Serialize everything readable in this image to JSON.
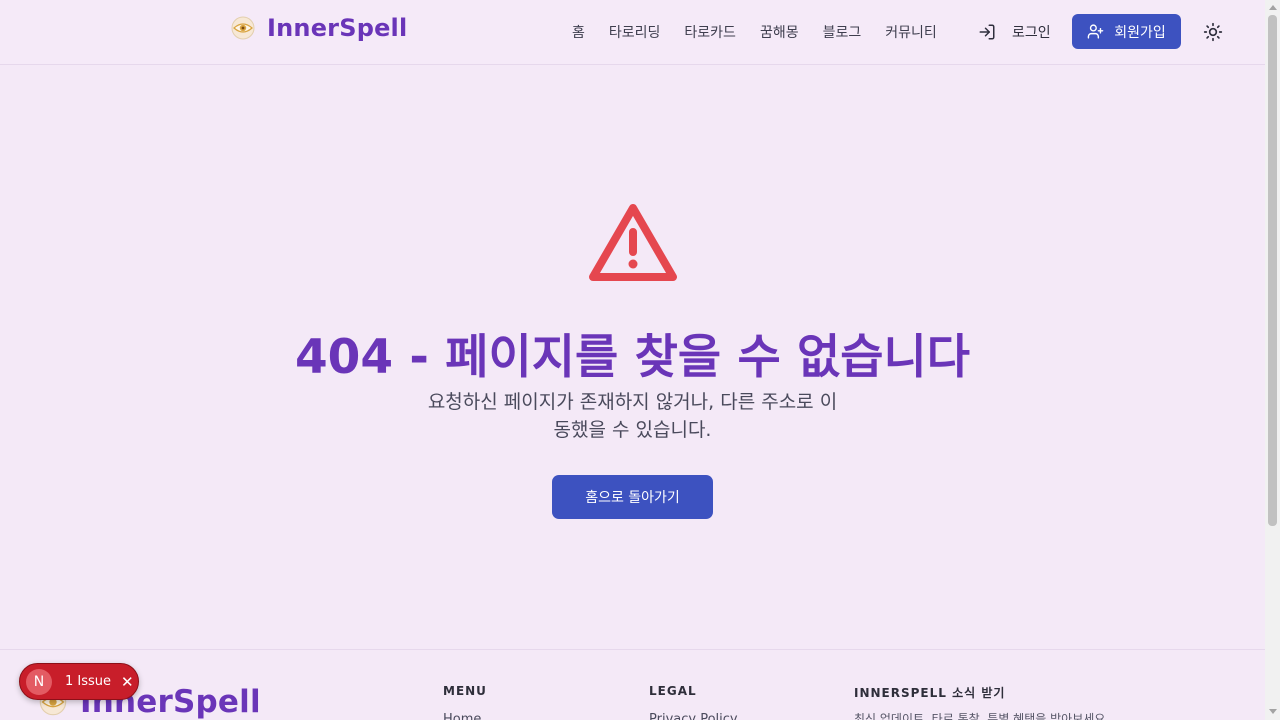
{
  "header": {
    "brand": "InnerSpell",
    "nav": [
      {
        "label": "홈"
      },
      {
        "label": "타로리딩"
      },
      {
        "label": "타로카드"
      },
      {
        "label": "꿈해몽"
      },
      {
        "label": "블로그"
      },
      {
        "label": "커뮤니티"
      }
    ],
    "login_label": "로그인",
    "signup_label": "회원가입",
    "theme_icon": "sun-icon"
  },
  "main": {
    "icon": "warning-triangle-icon",
    "title": "404 - 페이지를 찾을 수 없습니다",
    "description_line1": "요청하신 페이지가 존재하지 않거나, 다른 주소로 이",
    "description_line2": "동했을 수 있습니다.",
    "home_button": "홈으로 돌아가기"
  },
  "footer": {
    "brand": "InnerSpell",
    "menu_title": "MENU",
    "menu_first": "Home",
    "legal_title": "LEGAL",
    "legal_first": "Privacy Policy",
    "newsletter_title": "INNERSPELL 소식 받기",
    "newsletter_text": "최신 업데이트, 타로 통찰, 특별 혜택을 받아보세요."
  },
  "dev_overlay": {
    "avatar_letter": "N",
    "issue_text": "1 Issue",
    "close_glyph": "✕"
  },
  "colors": {
    "brand_purple": "#6a35b8",
    "primary_button": "#3d52c0",
    "warning_red": "#e5474f",
    "background": "#f4e9f7",
    "issue_badge": "#c81e2a"
  }
}
